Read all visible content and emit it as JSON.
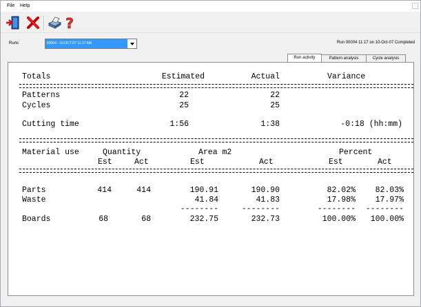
{
  "menu": {
    "file": "File",
    "help": "Help"
  },
  "toolbar": {
    "buttons": [
      {
        "icon": "exit-door-icon"
      },
      {
        "icon": "delete-x-icon"
      },
      {
        "icon": "print-icon"
      },
      {
        "icon": "help-question-icon"
      }
    ]
  },
  "runs": {
    "label": "Runs",
    "value": "00004 : 10-OCT-07 11:17 AM"
  },
  "status_text": "Run 00004 11:17 on 10-Oct-07 Completed",
  "tabs": [
    "Run activity",
    "Pattern analysis",
    "Cycle analysis"
  ],
  "report": {
    "totals": {
      "heading": "Totals",
      "col_estimated": "Estimated",
      "col_actual": "Actual",
      "col_variance": "Variance",
      "rows": [
        {
          "label": "Patterns",
          "estimated": "22",
          "actual": "22",
          "variance": ""
        },
        {
          "label": "Cycles",
          "estimated": "25",
          "actual": "25",
          "variance": ""
        },
        {
          "label": "Cutting time",
          "estimated": "1:56",
          "actual": "1:38",
          "variance": "-0:18 (hh:mm)"
        }
      ]
    },
    "material": {
      "heading": "Material use",
      "col_quantity": "Quantity",
      "col_area": "Area m2",
      "col_percent": "Percent",
      "sub_est": "Est",
      "sub_act": "Act",
      "rows": [
        {
          "label": "Parts",
          "qty_est": "414",
          "qty_act": "414",
          "area_est": "190.91",
          "area_act": "190.90",
          "pct_est": "82.02%",
          "pct_act": "82.03%"
        },
        {
          "label": "Waste",
          "qty_est": "",
          "qty_act": "",
          "area_est": "41.84",
          "area_act": "41.83",
          "pct_est": "17.98%",
          "pct_act": "17.97%"
        },
        {
          "label": "Boards",
          "qty_est": "68",
          "qty_act": "68",
          "area_est": "232.75",
          "area_act": "232.73",
          "pct_est": "100.00%",
          "pct_act": "100.00%"
        }
      ],
      "separator": "--------"
    }
  }
}
